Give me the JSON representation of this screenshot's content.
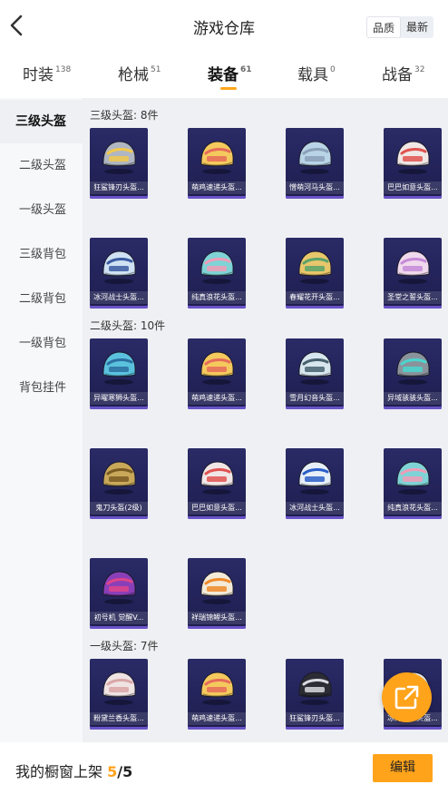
{
  "header": {
    "title": "游戏仓库",
    "sort_options": [
      "品质",
      "最新"
    ],
    "sort_active": 0
  },
  "tabs": [
    {
      "label": "时装",
      "count": "138"
    },
    {
      "label": "枪械",
      "count": "51"
    },
    {
      "label": "装备",
      "count": "61",
      "active": true
    },
    {
      "label": "载具",
      "count": "0"
    },
    {
      "label": "战备",
      "count": "32"
    }
  ],
  "sidebar": {
    "items": [
      "三级头盔",
      "二级头盔",
      "一级头盔",
      "三级背包",
      "二级背包",
      "一级背包",
      "背包挂件"
    ],
    "active": 0
  },
  "sections": [
    {
      "title": "三级头盔: 8件",
      "items": [
        {
          "name": "狂鲨锋刃头盔...",
          "icon": "helmet-icon",
          "color": "#b0b6c2",
          "accent": "#f2c94c"
        },
        {
          "name": "萌鸡速递头盔...",
          "icon": "helmet-icon",
          "color": "#f4c95d",
          "accent": "#e66b5b"
        },
        {
          "name": "憎萌河马头盔...",
          "icon": "helmet-icon",
          "color": "#b9d4e6",
          "accent": "#8aa0b8"
        },
        {
          "name": "巴巴如意头盔...",
          "icon": "helmet-icon",
          "color": "#f0e6e6",
          "accent": "#e0524f"
        },
        {
          "name": "冰河战士头盔...",
          "icon": "helmet-icon",
          "color": "#cfe2f3",
          "accent": "#3a5aa0"
        },
        {
          "name": "纯真浪花头盔...",
          "icon": "helmet-icon",
          "color": "#7fd3d6",
          "accent": "#f29bb6"
        },
        {
          "name": "春耀花开头盔...",
          "icon": "helmet-icon",
          "color": "#e8c66b",
          "accent": "#57a36a"
        },
        {
          "name": "圣堂之誓头盔...",
          "icon": "helmet-icon",
          "color": "#efd9ec",
          "accent": "#c58ad9"
        }
      ]
    },
    {
      "title": "二级头盔: 10件",
      "items": [
        {
          "name": "异曜寒狮头盔...",
          "icon": "helmet-icon",
          "color": "#5bc2de",
          "accent": "#2c6fa0"
        },
        {
          "name": "萌鸡速递头盔...",
          "icon": "helmet-icon",
          "color": "#f4c95d",
          "accent": "#e66b5b"
        },
        {
          "name": "雪月幻音头盔...",
          "icon": "helmet-icon",
          "color": "#d7e6ee",
          "accent": "#47606e"
        },
        {
          "name": "异域骇骇头盔...",
          "icon": "helmet-icon",
          "color": "#8a939c",
          "accent": "#4ad6cf"
        },
        {
          "name": "鬼刀头盔(2级)",
          "icon": "helmet-icon",
          "color": "#c9a85a",
          "accent": "#7a5b22"
        },
        {
          "name": "巴巴如意头盔...",
          "icon": "helmet-icon",
          "color": "#f0e6e6",
          "accent": "#e0524f"
        },
        {
          "name": "冰河战士头盔...",
          "icon": "helmet-icon",
          "color": "#e6eef8",
          "accent": "#2a5ec7"
        },
        {
          "name": "纯真浪花头盔...",
          "icon": "helmet-icon",
          "color": "#7fd3d6",
          "accent": "#f29bb6"
        },
        {
          "name": "初号机 觉醒V...",
          "icon": "helmet-icon",
          "color": "#8a3fb8",
          "accent": "#e0458a"
        },
        {
          "name": "祥瑞锦鲤头盔...",
          "icon": "helmet-icon",
          "color": "#f3ead8",
          "accent": "#f08a2a"
        }
      ]
    },
    {
      "title": "一级头盔: 7件",
      "items": [
        {
          "name": "粉黛兰香头盔...",
          "icon": "helmet-icon",
          "color": "#efe3e3",
          "accent": "#d9a6a6"
        },
        {
          "name": "萌鸡速递头盔...",
          "icon": "helmet-icon",
          "color": "#f4c95d",
          "accent": "#e66b5b"
        },
        {
          "name": "狂鲨锋刃头盔...",
          "icon": "helmet-icon",
          "color": "#2c2c34",
          "accent": "#d9dbe0"
        },
        {
          "name": "冰河战士头盔...",
          "icon": "helmet-icon",
          "color": "#e6eef8",
          "accent": "#2a5ec7"
        }
      ]
    }
  ],
  "fab": {
    "icon": "share-external-icon"
  },
  "bottom": {
    "label": "我的橱窗上架",
    "current": "5",
    "total": "/5",
    "edit_label": "编辑"
  },
  "colors": {
    "accent": "#ffa31a",
    "card_bg": "#26265e",
    "content_bg": "#eef0f3"
  }
}
